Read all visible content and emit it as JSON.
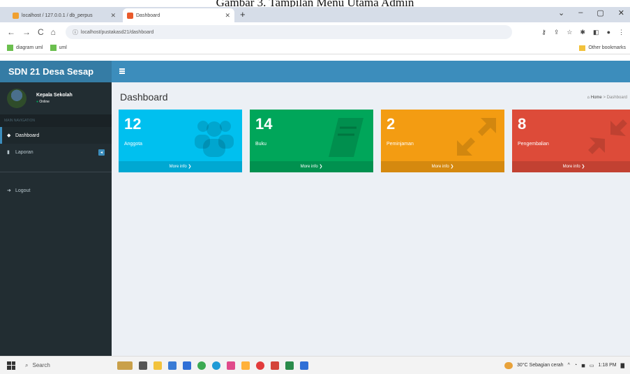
{
  "caption": "Gambar 3. Tampilan Menu Utama Admin",
  "browser": {
    "tabs": [
      {
        "label": "localhost / 127.0.0.1 / db_perpus",
        "favicon_color": "#f0a030"
      },
      {
        "label": "Dashboard",
        "favicon_color": "#e95a2b"
      }
    ],
    "new_tab": "+",
    "window_controls": [
      "⌄",
      "–",
      "▢",
      "✕"
    ],
    "nav": {
      "back": "←",
      "forward": "→",
      "reload": "C",
      "home": "⌂"
    },
    "url": "localhost/pustakasd21/dashboard",
    "bookmarks": [
      {
        "label": "diagram uml"
      },
      {
        "label": "uml"
      }
    ],
    "other_bookmarks": "Other bookmarks"
  },
  "app": {
    "brand": "SDN 21 Desa Sesap",
    "user": {
      "name": "Kepala Sekolah",
      "status": "Online"
    },
    "nav_header": "MAIN NAVIGATION",
    "menu": [
      {
        "label": "Dashboard",
        "icon": "dashboard-icon",
        "active": true
      },
      {
        "label": "Laporan",
        "icon": "book-icon",
        "badge": "◂"
      },
      {
        "label": "Logout",
        "icon": "logout-icon"
      }
    ],
    "page_title": "Dashboard",
    "breadcrumb": {
      "home": "Home",
      "sep": ">",
      "current": "Dashboard"
    },
    "boxes": [
      {
        "value": "12",
        "label": "Anggota",
        "footer": "More info ❯",
        "color": "#00c0ef",
        "icon": "users-icon"
      },
      {
        "value": "14",
        "label": "Buku",
        "footer": "More info ❯",
        "color": "#00a65a",
        "icon": "book-icon"
      },
      {
        "value": "2",
        "label": "Peminjaman",
        "footer": "More info ❯",
        "color": "#f39c12",
        "icon": "expand-arrows-icon"
      },
      {
        "value": "8",
        "label": "Pengembalian",
        "footer": "More info ❯",
        "color": "#dd4b39",
        "icon": "compress-arrows-icon"
      }
    ]
  },
  "taskbar": {
    "search": "Search",
    "weather": "30°C Sebagian cerah",
    "time": "1:18 PM"
  }
}
